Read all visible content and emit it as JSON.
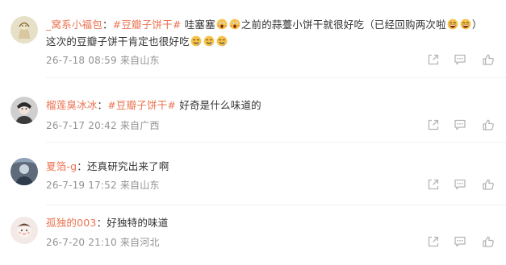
{
  "comments": [
    {
      "username": "_窝系小福包",
      "colon": "：",
      "topic": "#豆瓣子饼干#",
      "segments": {
        "t1": " 哇塞塞",
        "t2": "之前的蒜薹小饼干就很好吃（已经回购两次啦",
        "t3": "）",
        "t4": "这次的豆瓣子饼干肯定也很好吃"
      },
      "date": "26-7-18 08:59",
      "location": "来自山东"
    },
    {
      "username": "榴莲臭冰冰",
      "colon": "：",
      "topic": "#豆瓣子饼干#",
      "segments": {
        "t1": " 好奇是什么味道的"
      },
      "date": "26-7-17 20:42",
      "location": "来自广西"
    },
    {
      "username": "夏箔-g",
      "colon": "：",
      "topic": "",
      "segments": {
        "t1": "还真研究出来了啊"
      },
      "date": "26-7-19 17:52",
      "location": "来自山东"
    },
    {
      "username": "孤独的003",
      "colon": "：",
      "topic": "",
      "segments": {
        "t1": "好独特的味道"
      },
      "date": "26-7-20 21:10",
      "location": "来自河北"
    }
  ],
  "icons": {
    "share": "share-icon",
    "reply": "comment-icon",
    "like": "thumbs-up-icon",
    "emoji_scream": "scream-face-emoji",
    "emoji_grin": "grinning-face-emoji",
    "emoji_drool": "drooling-face-emoji"
  },
  "colors": {
    "username": "#eb7350",
    "topic": "#eb7350",
    "text": "#333333",
    "meta": "#939393",
    "icon": "#b5b5b5",
    "separator": "#f2f2f2"
  }
}
